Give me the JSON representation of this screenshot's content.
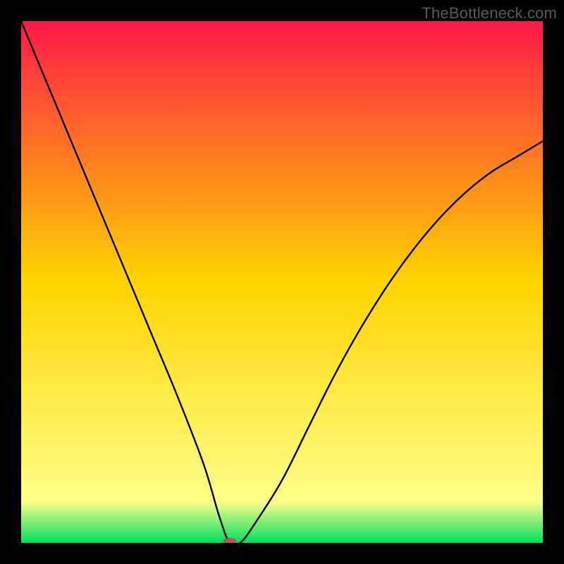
{
  "watermark": "TheBottleneck.com",
  "colors": {
    "gradient_top": "#ff1a47",
    "gradient_mid": "#ffd400",
    "gradient_low": "#ffff8a",
    "gradient_bottom": "#00e060",
    "curve": "#000000",
    "marker": "#c0534b",
    "frame_bg": "#000000"
  },
  "chart_data": {
    "type": "line",
    "title": "",
    "xlabel": "",
    "ylabel": "",
    "xlim": [
      0,
      100
    ],
    "ylim": [
      0,
      100
    ],
    "optimal_x": 40,
    "marker": {
      "x": 40,
      "y": 0
    },
    "series": [
      {
        "name": "bottleneck-curve",
        "x": [
          0,
          5,
          10,
          15,
          20,
          25,
          30,
          35,
          38,
          40,
          42,
          45,
          50,
          55,
          60,
          65,
          70,
          75,
          80,
          85,
          90,
          95,
          100
        ],
        "values": [
          100,
          88,
          76,
          64,
          52,
          40,
          28,
          15,
          5,
          0,
          0,
          4,
          12,
          22,
          32,
          41,
          49,
          56,
          62,
          67,
          71,
          74,
          77
        ]
      }
    ],
    "gradient_stops": [
      {
        "offset": 0,
        "color": "#ff1a47"
      },
      {
        "offset": 50,
        "color": "#ffd400"
      },
      {
        "offset": 92,
        "color": "#ffff8a"
      },
      {
        "offset": 100,
        "color": "#00e060"
      }
    ]
  }
}
